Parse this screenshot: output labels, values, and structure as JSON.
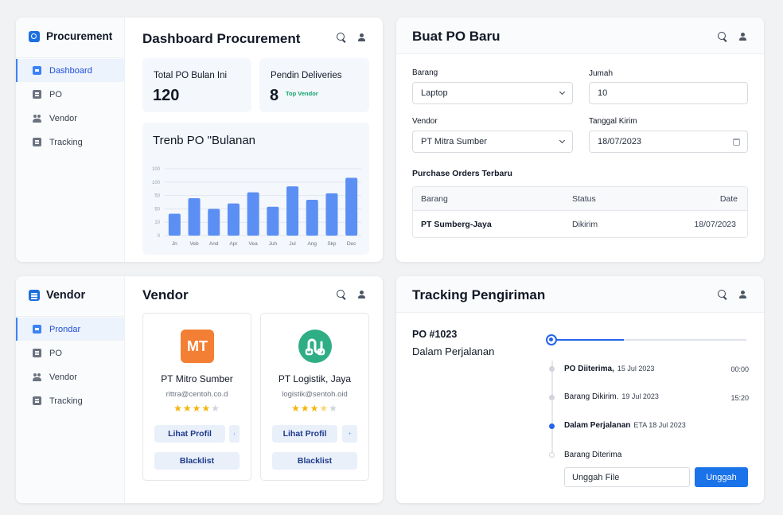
{
  "dashboard": {
    "brand": "Procurement",
    "nav": [
      {
        "label": "Dashboard",
        "icon": "dashboard-icon",
        "active": true
      },
      {
        "label": "PO",
        "icon": "document-icon"
      },
      {
        "label": "Vendor",
        "icon": "users-icon"
      },
      {
        "label": "Tracking",
        "icon": "document-icon"
      }
    ],
    "title": "Dashboard Procurement",
    "stat_total": {
      "label": "Total PO Bulan Ini",
      "value": "120"
    },
    "stat_pending": {
      "label": "Pendin Deliveries",
      "value": "8",
      "badge": "Top Vendor"
    },
    "chart_title": "Trenb PO \"Bulanan"
  },
  "chart_data": {
    "type": "bar",
    "title": "Trenb PO \"Bulanan",
    "categories": [
      "Jn",
      "Veb",
      "And",
      "Apr",
      "Vea",
      "Juh",
      "Jul",
      "Ang",
      "Skp",
      "Dec"
    ],
    "values": [
      41,
      70,
      50,
      60,
      81,
      54,
      92,
      67,
      79,
      108
    ],
    "yticks": [
      "0",
      "10",
      "50",
      "50",
      "100",
      "100"
    ],
    "ylim": [
      0,
      125
    ],
    "grid": true,
    "color": "#5b8ff3"
  },
  "po_form": {
    "title": "Buat PO Baru",
    "barang_label": "Barang",
    "barang_value": "Laptop",
    "jumlah_label": "Jumah",
    "jumlah_value": "10",
    "vendor_label": "Vendor",
    "vendor_value": "PT Mitra Sumber",
    "tanggal_label": "Tanggal Kirim",
    "tanggal_value": "18/07/2023",
    "recent_title": "Purchase Orders Terbaru",
    "columns": {
      "barang": "Barang",
      "status": "Status",
      "date": "Date"
    },
    "row": {
      "barang": "PT Sumberg-Jaya",
      "status": "Dikirim",
      "date": "18/07/2023"
    }
  },
  "vendor": {
    "brand": "Vendor",
    "nav": [
      {
        "label": "Prondar",
        "icon": "dashboard-icon",
        "active": true
      },
      {
        "label": "PO",
        "icon": "document-icon"
      },
      {
        "label": "Vendor",
        "icon": "users-icon"
      },
      {
        "label": "Tracking",
        "icon": "document-icon"
      }
    ],
    "title": "Vendor",
    "cards": [
      {
        "logo_text": "MT",
        "name": "PT Mitro Sumber",
        "email": "rittra@centoh.co.d",
        "rating": 4,
        "rating_half": false,
        "profile_label": "Lihat Profil",
        "blacklist_label": "Blacklist",
        "mini_glyph": "›"
      },
      {
        "logo_text": "",
        "name": "PT Logistik, Jaya",
        "email": "logistik@sentoh.oid",
        "rating": 3,
        "rating_half": true,
        "profile_label": "Lihat Profil",
        "blacklist_label": "Blacklist",
        "mini_glyph": "+"
      }
    ]
  },
  "tracking": {
    "title": "Tracking Pengiriman",
    "po_id": "PO #1023",
    "status": "Dalam Perjalanan",
    "progress": 0.37,
    "events": [
      {
        "label": "PO Diiterima,",
        "date": "15 Jul 2023",
        "time": "00:00",
        "bold": true
      },
      {
        "label": "Barang Dikirim.",
        "date": "19 Jul 2023",
        "time": "15:20",
        "bold": false
      },
      {
        "label": "Dalam Perjalanan",
        "date": "ETA 18 Jul 2023",
        "time": "",
        "bold": true
      },
      {
        "label": "Barang Diterima",
        "date": "",
        "time": "",
        "bold": false
      }
    ],
    "upload_placeholder": "Unggah File",
    "upload_button": "Unggah"
  }
}
